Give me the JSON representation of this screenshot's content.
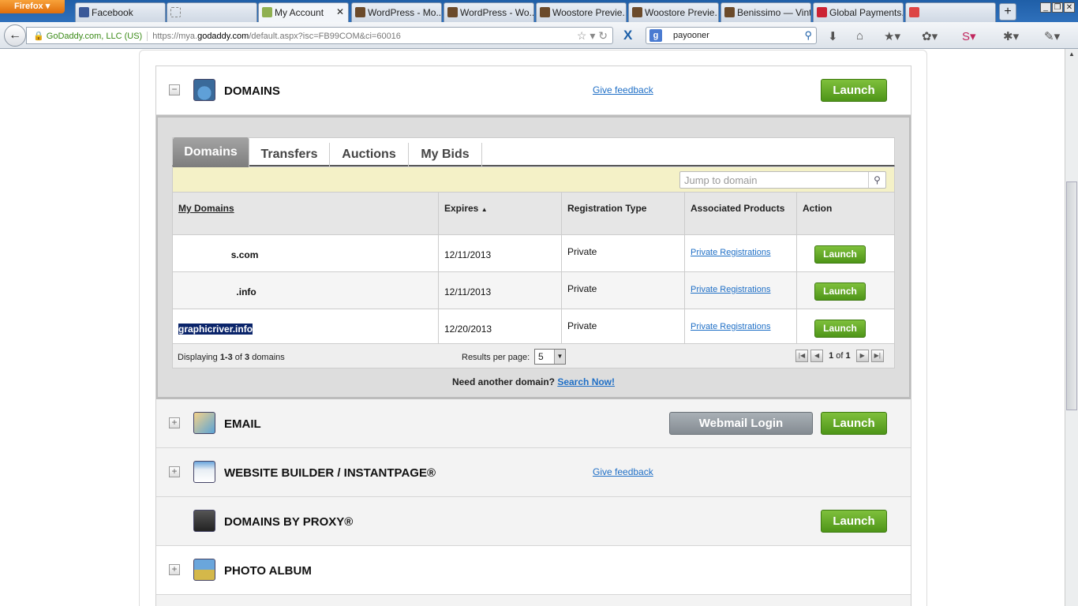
{
  "browser": {
    "menu_label": "Firefox",
    "tabs": [
      {
        "label": "Facebook",
        "favicon_color": "#3b5998",
        "active": false
      },
      {
        "label": "",
        "favicon_color": "#ffffff",
        "active": false
      },
      {
        "label": "My Account",
        "favicon_color": "#ffffff",
        "active": true
      },
      {
        "label": "WordPress - Mo...",
        "favicon_color": "#6b4a2a",
        "active": false
      },
      {
        "label": "WordPress - Wo...",
        "favicon_color": "#6b4a2a",
        "active": false
      },
      {
        "label": "Woostore Previe...",
        "favicon_color": "#6b4a2a",
        "active": false
      },
      {
        "label": "Woostore Previe...",
        "favicon_color": "#6b4a2a",
        "active": false
      },
      {
        "label": "Benissimo — Vint...",
        "favicon_color": "#6b4a2a",
        "active": false
      },
      {
        "label": "Global Payments...",
        "favicon_color": "#cc2233",
        "active": false
      },
      {
        "label": "",
        "favicon_color": "#d44",
        "active": false
      }
    ],
    "identity_label": "GoDaddy.com, LLC (US)",
    "url_scheme": "https://mya.",
    "url_host": "godaddy.com",
    "url_rest": "/default.aspx?isc=FB99COM&ci=60016",
    "search_value": "payooner"
  },
  "products": {
    "domains": {
      "name": "DOMAINS",
      "feedback": "Give feedback",
      "launch": "Launch"
    },
    "email": {
      "name": "EMAIL",
      "webmail": "Webmail Login",
      "launch": "Launch"
    },
    "website_builder": {
      "name": "WEBSITE BUILDER / INSTANTPAGE®",
      "feedback": "Give feedback"
    },
    "proxy": {
      "name": "DOMAINS BY PROXY®",
      "launch": "Launch"
    },
    "photo": {
      "name": "PHOTO ALBUM"
    }
  },
  "domain_tabs": [
    "Domains",
    "Transfers",
    "Auctions",
    "My Bids"
  ],
  "jump_placeholder": "Jump to domain",
  "table": {
    "headers": [
      "My Domains",
      "Expires",
      "Registration Type",
      "Associated Products",
      "Action"
    ],
    "rows": [
      {
        "domain": "s.com",
        "expires": "12/11/2013",
        "type": "Private",
        "assoc": "Private Registrations",
        "action": "Launch"
      },
      {
        "domain": ".info",
        "expires": "12/11/2013",
        "type": "Private",
        "assoc": "Private Registrations",
        "action": "Launch"
      },
      {
        "domain": "graphicriver.info",
        "expires": "12/20/2013",
        "type": "Private",
        "assoc": "Private Registrations",
        "action": "Launch"
      }
    ]
  },
  "pager": {
    "displaying_prefix": "Displaying ",
    "displaying_range": "1-3",
    "displaying_of": " of ",
    "displaying_total": "3",
    "displaying_suffix": " domains",
    "results_label": "Results per page:",
    "results_value": "5",
    "page_current": "1",
    "page_of": " of ",
    "page_total": "1"
  },
  "need_more": {
    "text": "Need another domain?",
    "link": "Search Now!"
  }
}
